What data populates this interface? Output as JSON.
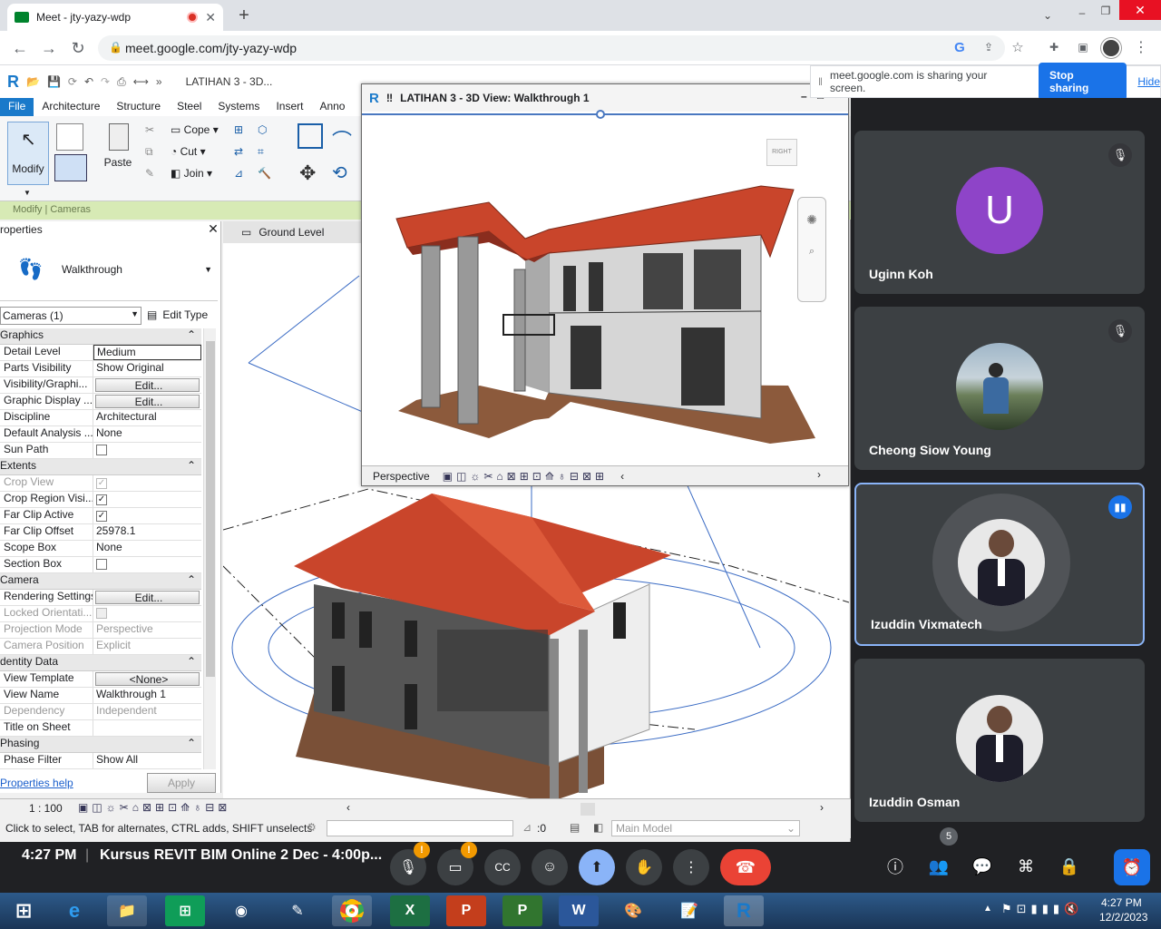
{
  "browser": {
    "tab_title": "Meet - jty-yazy-wdp",
    "url": "meet.google.com/jty-yazy-wdp"
  },
  "revit": {
    "qat_title": "LATIHAN 3 - 3D...",
    "ribbon_tabs": [
      "File",
      "Architecture",
      "Structure",
      "Steel",
      "Systems",
      "Insert",
      "Anno"
    ],
    "modify_label": "Modify",
    "paste_label": "Paste",
    "cope_label": "Cope",
    "cut_label": "Cut",
    "join_label": "Join",
    "context_label": "Modify | Cameras",
    "properties_title": "roperties",
    "type_name": "Walkthrough",
    "selector_value": "Cameras (1)",
    "edit_type_label": "Edit Type",
    "sections": {
      "graphics": "Graphics",
      "extents": "Extents",
      "camera": "Camera",
      "identity": "dentity Data",
      "phasing": "Phasing"
    },
    "rows": {
      "detail_level": {
        "k": "Detail Level",
        "v": "Medium"
      },
      "parts_visibility": {
        "k": "Parts Visibility",
        "v": "Show Original"
      },
      "vis_graphics": {
        "k": "Visibility/Graphi...",
        "v": "Edit..."
      },
      "graphic_display": {
        "k": "Graphic Display ...",
        "v": "Edit..."
      },
      "discipline": {
        "k": "Discipline",
        "v": "Architectural"
      },
      "default_analysis": {
        "k": "Default Analysis ...",
        "v": "None"
      },
      "sun_path": {
        "k": "Sun Path",
        "v": ""
      },
      "crop_view": {
        "k": "Crop View",
        "v": ""
      },
      "crop_region": {
        "k": "Crop Region Visi...",
        "v": ""
      },
      "far_clip_active": {
        "k": "Far Clip Active",
        "v": ""
      },
      "far_clip_offset": {
        "k": "Far Clip Offset",
        "v": "25978.1"
      },
      "scope_box": {
        "k": "Scope Box",
        "v": "None"
      },
      "section_box": {
        "k": "Section Box",
        "v": ""
      },
      "rendering": {
        "k": "Rendering Settings",
        "v": "Edit..."
      },
      "locked_orient": {
        "k": "Locked Orientati...",
        "v": ""
      },
      "projection": {
        "k": "Projection Mode",
        "v": "Perspective"
      },
      "camera_pos": {
        "k": "Camera Position",
        "v": "Explicit"
      },
      "view_template": {
        "k": "View Template",
        "v": "<None>"
      },
      "view_name": {
        "k": "View Name",
        "v": "Walkthrough 1"
      },
      "dependency": {
        "k": "Dependency",
        "v": "Independent"
      },
      "title_sheet": {
        "k": "Title on Sheet",
        "v": ""
      },
      "phase_filter": {
        "k": "Phase Filter",
        "v": "Show All"
      }
    },
    "properties_help": "Properties help",
    "apply_label": "Apply",
    "view_tab": "Ground Level",
    "scale": "1 : 100",
    "status_text": "Click to select, TAB for alternates, CTRL adds, SHIFT unselects",
    "filter_count": ":0",
    "workset": "Main Model"
  },
  "window3d": {
    "title": "LATIHAN 3 - 3D View: Walkthrough 1",
    "viewcube_label": "RIGHT",
    "mode": "Perspective"
  },
  "share": {
    "message": "meet.google.com is sharing your screen.",
    "stop_label": "Stop sharing",
    "hide_label": "Hide"
  },
  "participants": [
    {
      "name": "Uginn Koh",
      "initial": "U",
      "muted": true
    },
    {
      "name": "Cheong Siow Young",
      "muted": true
    },
    {
      "name": "Izuddin Vixmatech",
      "speaking": true
    },
    {
      "name": "Izuddin Osman"
    }
  ],
  "meetbar": {
    "time": "4:27 PM",
    "meeting_title": "Kursus REVIT BIM Online 2 Dec - 4:00p...",
    "people_count": "5"
  },
  "taskbar": {
    "clock_time": "4:27 PM",
    "clock_date": "12/2/2023"
  },
  "colors": {
    "accent": "#1a73e8",
    "hangup": "#ea4335",
    "avatar_purple": "#8e44c8",
    "roof": "#c9452b"
  }
}
